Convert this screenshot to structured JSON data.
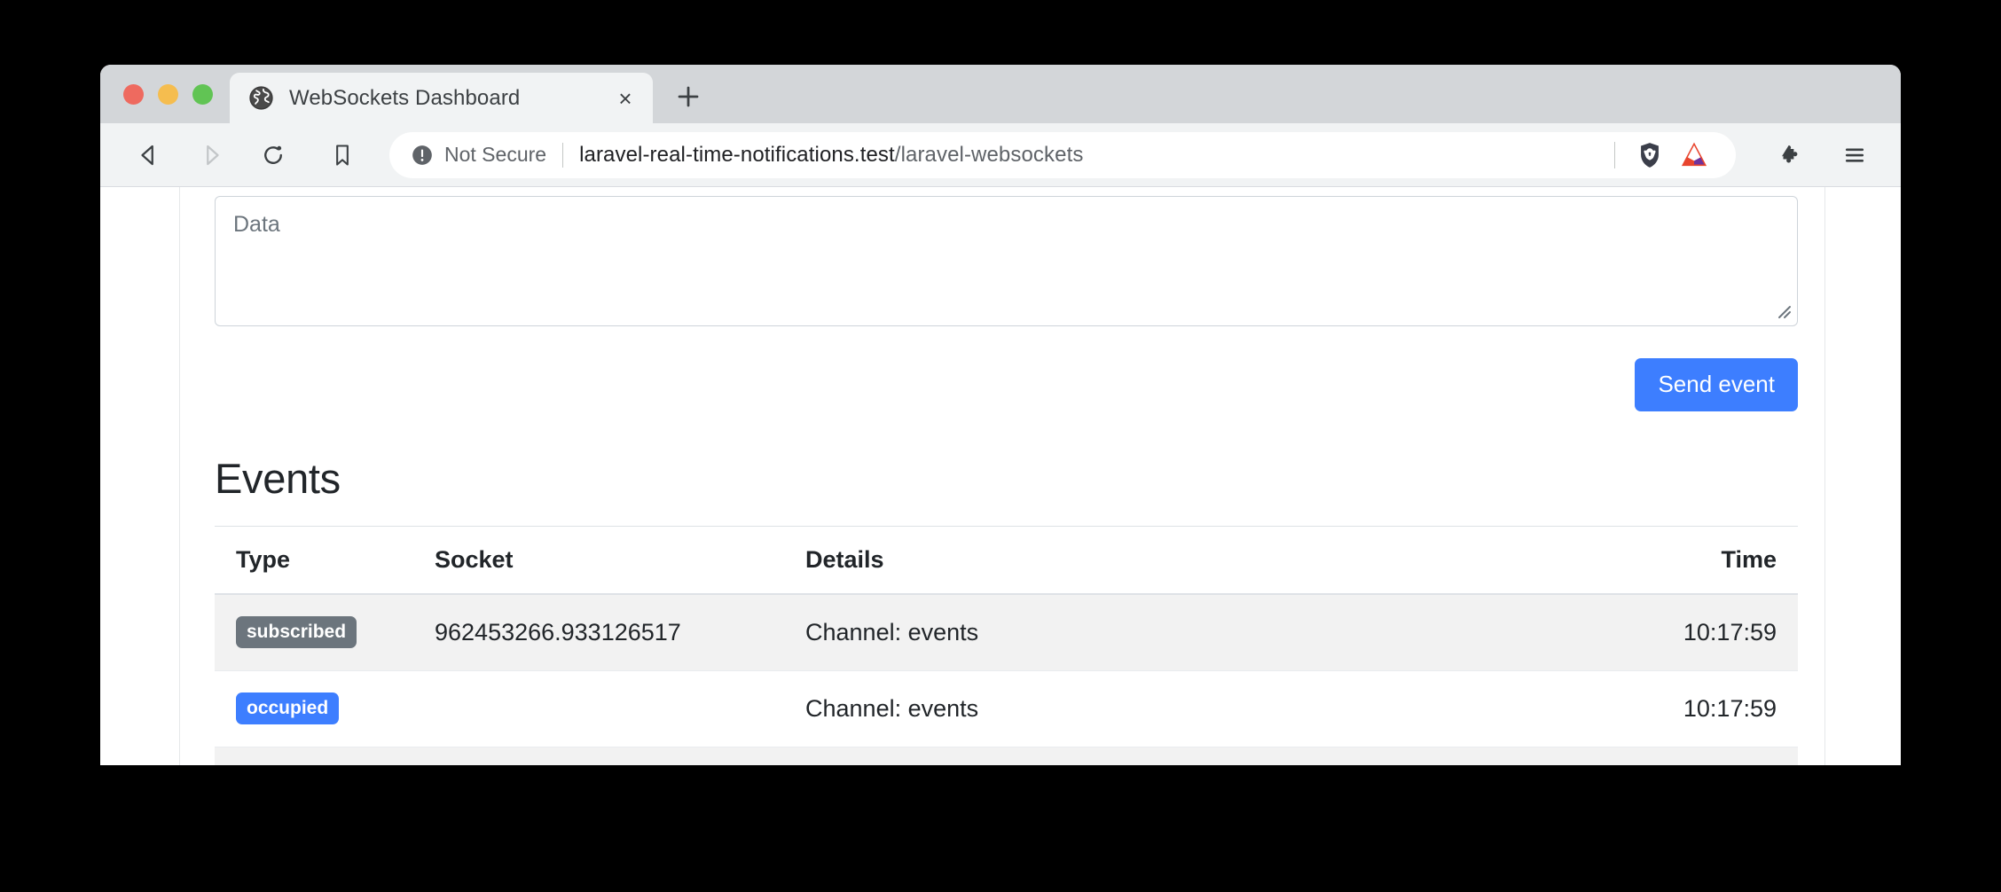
{
  "window": {
    "traffic_lights": [
      "close",
      "minimize",
      "maximize"
    ]
  },
  "tabbar": {
    "tab_title": "WebSockets Dashboard",
    "close_label": "×",
    "new_tab_label": "+"
  },
  "toolbar": {
    "security_label": "Not Secure",
    "url_host": "laravel-real-time-notifications.test",
    "url_path": "/laravel-websockets",
    "url_full": "laravel-real-time-notifications.test/laravel-websockets"
  },
  "form": {
    "data_placeholder": "Data",
    "data_value": "",
    "send_label": "Send event"
  },
  "events": {
    "heading": "Events",
    "columns": [
      "Type",
      "Socket",
      "Details",
      "Time"
    ],
    "rows": [
      {
        "type": "subscribed",
        "badge_variant": "secondary",
        "socket": "962453266.933126517",
        "details": "Channel: events",
        "time": "10:17:59"
      },
      {
        "type": "occupied",
        "badge_variant": "primary",
        "socket": "",
        "details": "Channel: events",
        "time": "10:17:59"
      }
    ]
  },
  "colors": {
    "accent_blue": "#3d7eff",
    "badge_secondary": "#6c757d",
    "tabstrip": "#d3d6d9",
    "toolbar": "#f1f3f4",
    "stripe": "#f2f2f2"
  }
}
